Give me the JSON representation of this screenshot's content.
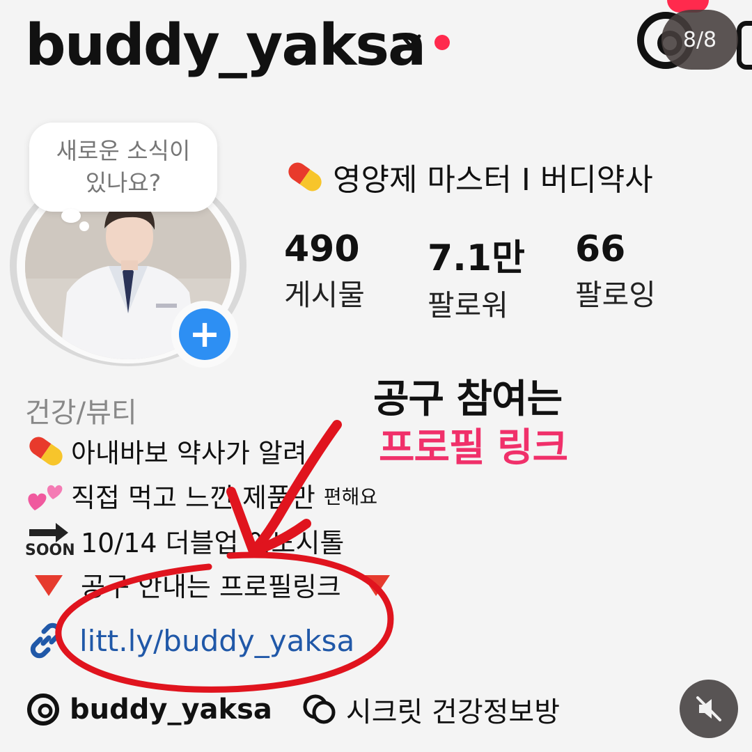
{
  "header": {
    "username": "buddy_yaksa",
    "page_counter": "8/8"
  },
  "profile": {
    "note_bubble": [
      "새로운 소식이",
      "있나요?"
    ],
    "display_name": "영양제 마스터 I 버디약사",
    "stats": [
      {
        "value": "490",
        "label": "게시물"
      },
      {
        "value": "7.1만",
        "label": "팔로워"
      },
      {
        "value": "66",
        "label": "팔로잉"
      }
    ],
    "category": "건강/뷰티",
    "bio": [
      {
        "icon": "pill-icon",
        "text": "아내바보 약사가 알려"
      },
      {
        "icon": "two-hearts-icon",
        "text": "직접 먹고 느낀 제품만",
        "suffix": "편해요"
      },
      {
        "icon": "soon-arrow-icon",
        "text": "10/14 더블업 이노시톨"
      },
      {
        "icon": "red-triangle-down-icon",
        "text": "공구 안내는 프로필링크"
      }
    ],
    "soon_label": "SOON",
    "link": "litt.ly/buddy_yaksa",
    "threads_handle": "buddy_yaksa",
    "channel_label": "시크릿 건강정보방"
  },
  "overlay": {
    "callout_line1": "공구 참여는",
    "callout_line2": "프로필 링크"
  },
  "colors": {
    "accent_blue": "#2d8ff3",
    "link_blue": "#2058a8",
    "callout_pink": "#f0306a",
    "annotation_red": "#e0141e",
    "notification_red": "#ff2a4d"
  }
}
